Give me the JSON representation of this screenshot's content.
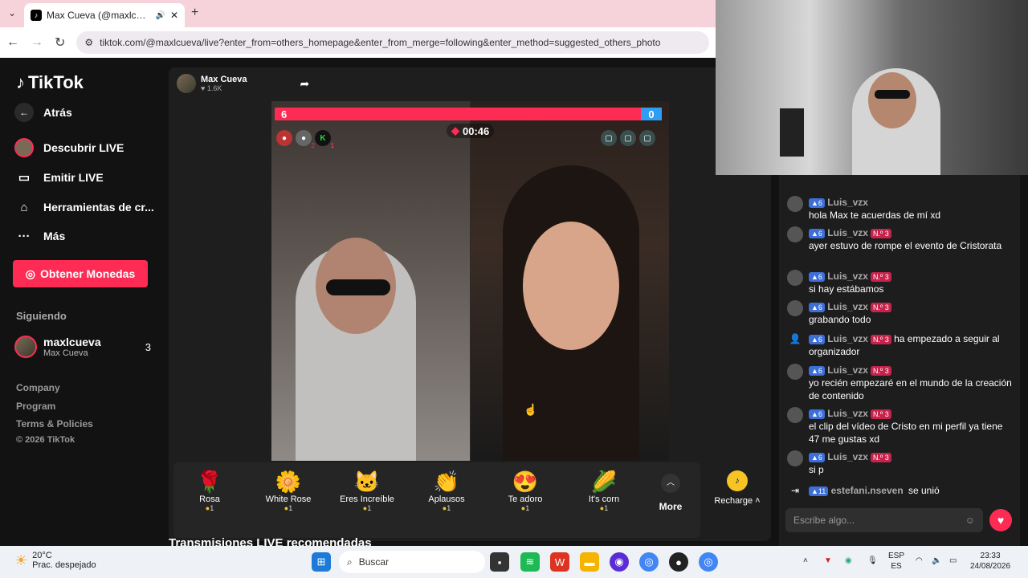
{
  "browser": {
    "tab_title": "Max Cueva (@maxlcueva) e",
    "url": "tiktok.com/@maxlcueva/live?enter_from=others_homepage&enter_from_merge=following&enter_method=suggested_others_photo"
  },
  "sidebar": {
    "logo": "TikTok",
    "items": [
      {
        "label": "Atrás"
      },
      {
        "label": "Descubrir LIVE"
      },
      {
        "label": "Emitir LIVE"
      },
      {
        "label": "Herramientas de cr..."
      },
      {
        "label": "Más"
      }
    ],
    "coins_button": "Obtener Monedas",
    "following_heading": "Siguiendo",
    "following": {
      "username": "maxlcueva",
      "name": "Max Cueva",
      "count": "3",
      "badge": "LIVE"
    },
    "footer": [
      "Company",
      "Program",
      "Terms & Policies",
      "© 2026 TikTok"
    ]
  },
  "stream": {
    "host_name": "Max Cueva",
    "host_likes": "1.6K",
    "pk_left": "6",
    "pk_right": "0",
    "timer": "00:46",
    "seat_badges": [
      "2",
      "1"
    ]
  },
  "gifts": [
    {
      "name": "Rosa",
      "price": "1",
      "icon": "🌹"
    },
    {
      "name": "White Rose",
      "price": "1",
      "icon": "🌼"
    },
    {
      "name": "Eres Increíble",
      "price": "1",
      "icon": "🐱"
    },
    {
      "name": "Aplausos",
      "price": "1",
      "icon": "👏"
    },
    {
      "name": "Te adoro",
      "price": "1",
      "icon": "😍"
    },
    {
      "name": "It's corn",
      "price": "1",
      "icon": "🌽"
    }
  ],
  "gift_more": "More",
  "recharge": "Recharge",
  "recommended_title": "Transmisiones LIVE recomendadas",
  "chat": {
    "messages": [
      {
        "user": "Luis_vzx",
        "level": "6",
        "fan": "",
        "text": "hola Max te acuerdas de mí xd"
      },
      {
        "user": "Luis_vzx",
        "level": "6",
        "fan": "N.º 3",
        "text": "ayer estuvo de rompe el evento de Cristorata"
      },
      {
        "user": "Luis_vzx",
        "level": "6",
        "fan": "N.º 3",
        "text": "si hay estábamos"
      },
      {
        "user": "Luis_vzx",
        "level": "6",
        "fan": "N.º 3",
        "text": "grabando todo"
      },
      {
        "user": "Luis_vzx",
        "level": "6",
        "fan": "N.º 3",
        "text": "ha empezado a seguir al organizador"
      },
      {
        "user": "Luis_vzx",
        "level": "6",
        "fan": "N.º 3",
        "text": "yo recién empezaré en el mundo de la creación de contenido"
      },
      {
        "user": "Luis_vzx",
        "level": "6",
        "fan": "N.º 3",
        "text": "el clip del vídeo de Cristo en mi perfil ya tiene 47 me gustas xd"
      },
      {
        "user": "Luis_vzx",
        "level": "6",
        "fan": "N.º 3",
        "text": "si p"
      },
      {
        "user": "estefani.nseven",
        "level": "11",
        "fan": "",
        "text": "se unió"
      }
    ],
    "input_placeholder": "Escribe algo..."
  },
  "taskbar": {
    "temp": "20°C",
    "weather": "Prac. despejado",
    "search": "Buscar",
    "lang1": "ESP",
    "lang2": "ES",
    "time": "23:33",
    "date": "24/08/2026"
  }
}
